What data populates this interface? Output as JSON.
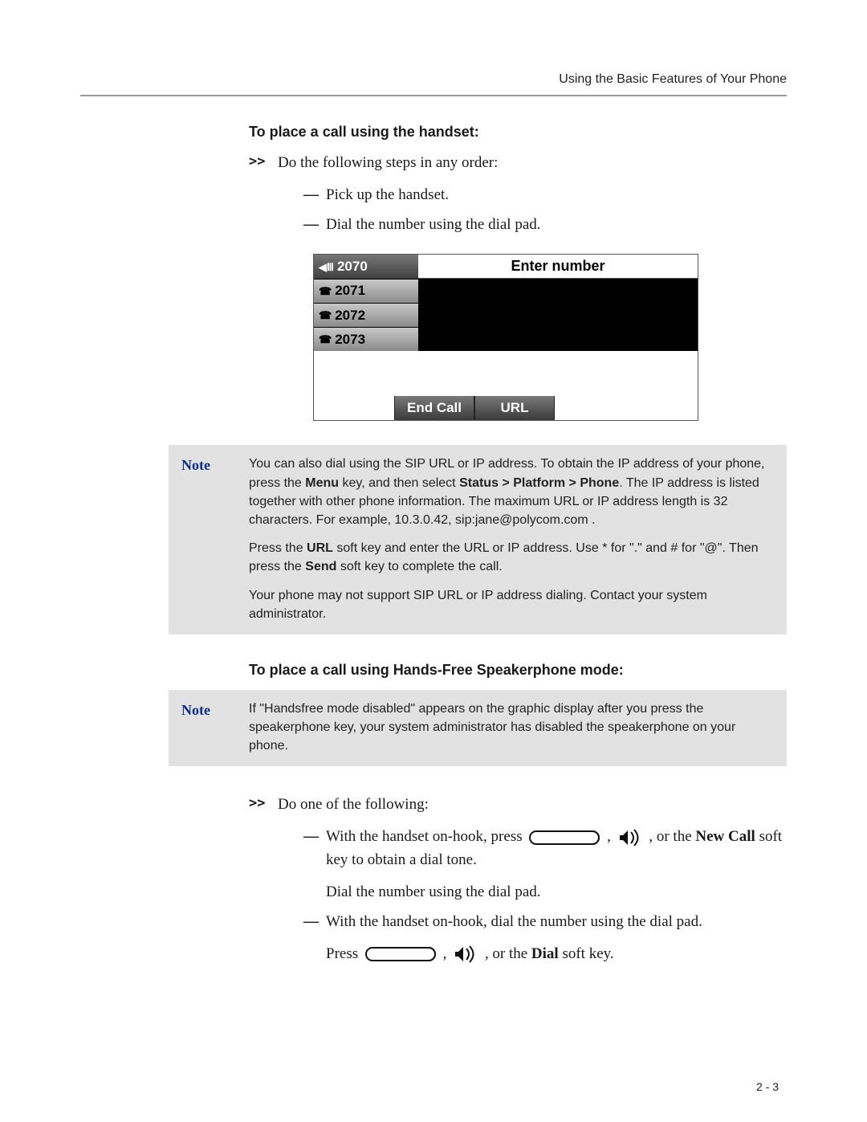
{
  "header": {
    "running": "Using the Basic Features of Your Phone"
  },
  "section1": {
    "title": "To place a call using the handset:",
    "intro": "Do the following steps in any order:",
    "steps": [
      "Pick up the handset.",
      "Dial the number using the dial pad."
    ]
  },
  "phone_mock": {
    "lines": [
      "2070",
      "2071",
      "2072",
      "2073"
    ],
    "prompt": "Enter number",
    "softkeys": [
      "End Call",
      "URL"
    ]
  },
  "note1": {
    "label": "Note",
    "p1_a": "You can also dial using the SIP URL or IP address. To obtain the IP address of your phone, press the ",
    "p1_menu": "Menu",
    "p1_b": " key, and then select ",
    "p1_path": "Status > Platform > Phone",
    "p1_c": ". The IP address is listed together with other phone information. The maximum URL or IP address length is 32 characters. For example, 10.3.0.42, sip:jane@polycom.com .",
    "p2_a": "Press the ",
    "p2_url": "URL",
    "p2_b": " soft key and enter the URL or IP address. Use * for \".\" and # for \"@\". Then press the ",
    "p2_send": "Send",
    "p2_c": " soft key to complete the call.",
    "p3": "Your phone may not support SIP URL or IP address dialing. Contact your system administrator."
  },
  "section2": {
    "title": "To place a call using Hands-Free Speakerphone mode:"
  },
  "note2": {
    "label": "Note",
    "p1": "If \"Handsfree mode disabled\" appears on the graphic display after you press the speakerphone key, your system administrator has disabled the speakerphone on your phone."
  },
  "list2": {
    "intro": "Do one of the following:",
    "b1_a": "With the handset on-hook, press ",
    "b1_b": " , ",
    "b1_c": " , or the ",
    "b1_new": "New Call",
    "b1_d": " soft key to obtain a dial tone.",
    "b1_e": "Dial the number using the dial pad.",
    "b2_a": "With the handset on-hook, dial the number using the dial pad.",
    "b2_b": "Press ",
    "b2_c": " , ",
    "b2_d": " , or the ",
    "b2_dial": "Dial",
    "b2_e": " soft key."
  },
  "footer": {
    "page": "2 - 3"
  }
}
